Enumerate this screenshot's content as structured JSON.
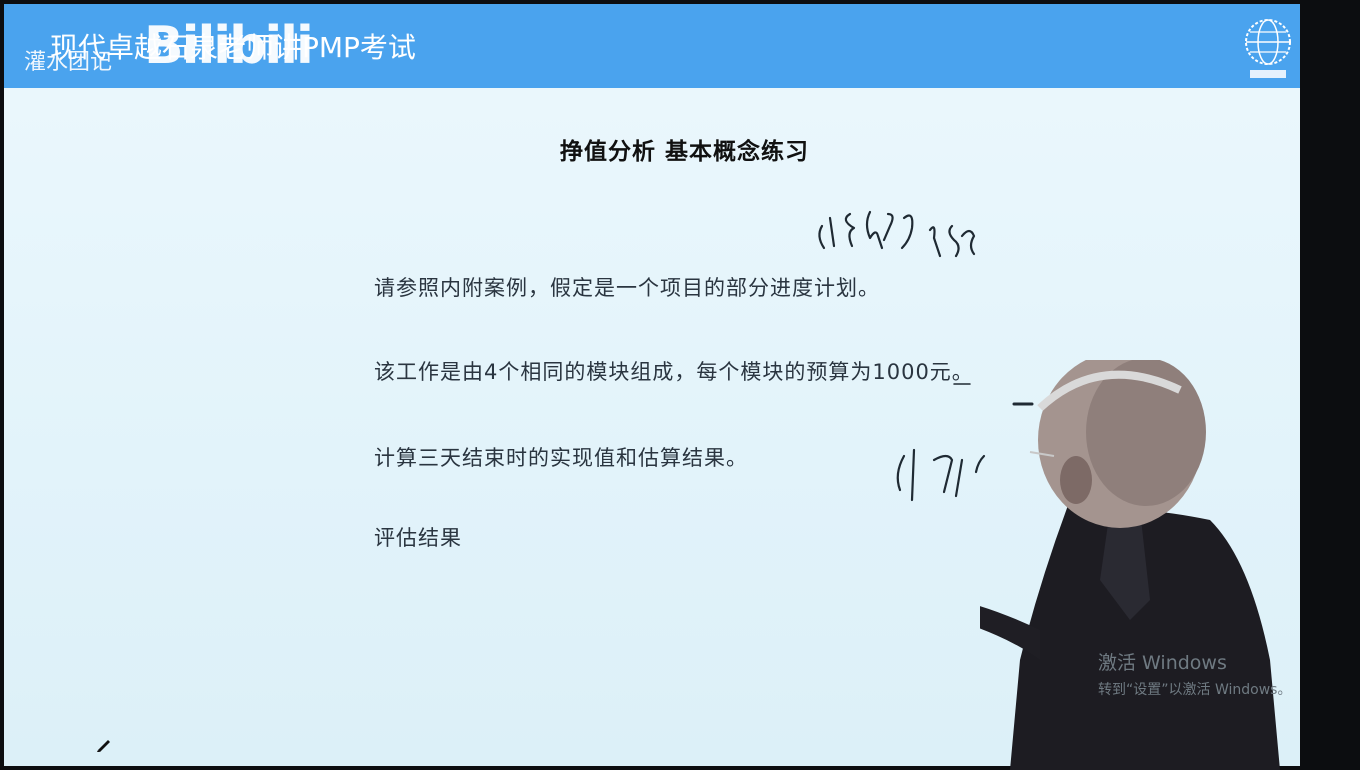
{
  "header": {
    "title": "现代卓越石泉老师讲PMP考试",
    "subtitle": "灌水团记",
    "watermark": "Bilibili",
    "logo_caption": "现代卓越"
  },
  "slide": {
    "title": "挣值分析 基本概念练习",
    "paragraphs": [
      "请参照内附案例，假定是一个项目的部分进度计划。",
      "该工作是由4个相同的模块组成，每个模块的预算为1000元。",
      "计算三天结束时的实现值和估算结果。",
      "评估结果"
    ]
  },
  "windows_activation": {
    "line1": "激活 Windows",
    "line2": "转到“设置”以激活 Windows。"
  },
  "colors": {
    "header_bar": "#4aa3ee",
    "slide_bg": "#e6f5fb",
    "text": "#2a3540",
    "title": "#111111"
  }
}
